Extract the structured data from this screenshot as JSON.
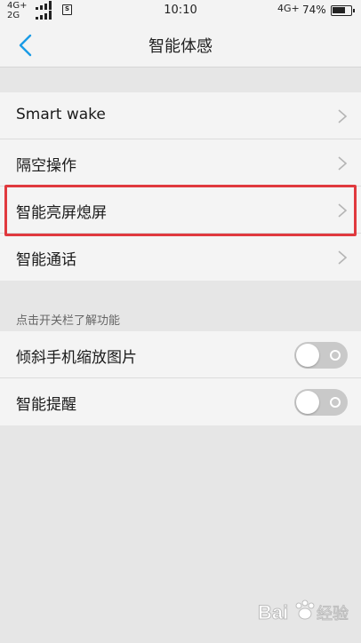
{
  "status_bar": {
    "sim1_network": "4G+",
    "sim2_network": "2G",
    "sim_icon": "sim-card-icon",
    "time": "10:10",
    "right_network": "4G+",
    "battery_percent": "74%",
    "battery_level": 0.74
  },
  "nav": {
    "back_icon": "chevron-left-icon",
    "title": "智能体感",
    "accent": "#1a9be6"
  },
  "menu_items": [
    {
      "label": "Smart wake",
      "icon": "chevron-right-icon"
    },
    {
      "label": "隔空操作",
      "icon": "chevron-right-icon"
    },
    {
      "label": "智能亮屏熄屏",
      "icon": "chevron-right-icon",
      "highlighted": true
    },
    {
      "label": "智能通话",
      "icon": "chevron-right-icon"
    }
  ],
  "section_header": "点击开关栏了解功能",
  "toggle_items": [
    {
      "label": "倾斜手机缩放图片",
      "on": false
    },
    {
      "label": "智能提醒",
      "on": false
    }
  ],
  "highlight_color": "#e0393e",
  "watermark": {
    "text": "Bai",
    "suffix": "经验"
  }
}
